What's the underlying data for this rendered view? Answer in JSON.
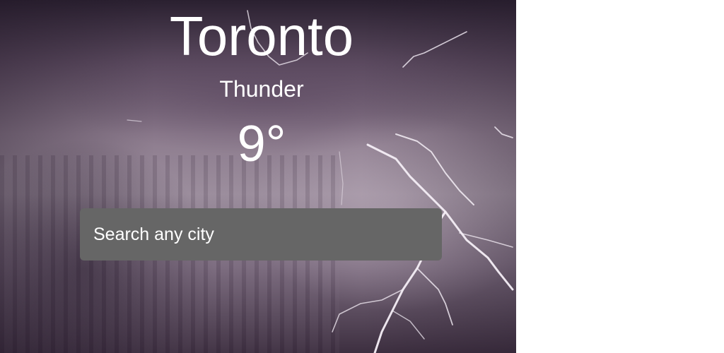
{
  "weather": {
    "city": "Toronto",
    "condition": "Thunder",
    "temperature": "9°"
  },
  "search": {
    "placeholder": "Search any city",
    "value": ""
  },
  "background": {
    "scene": "lightning-storm-sky"
  }
}
